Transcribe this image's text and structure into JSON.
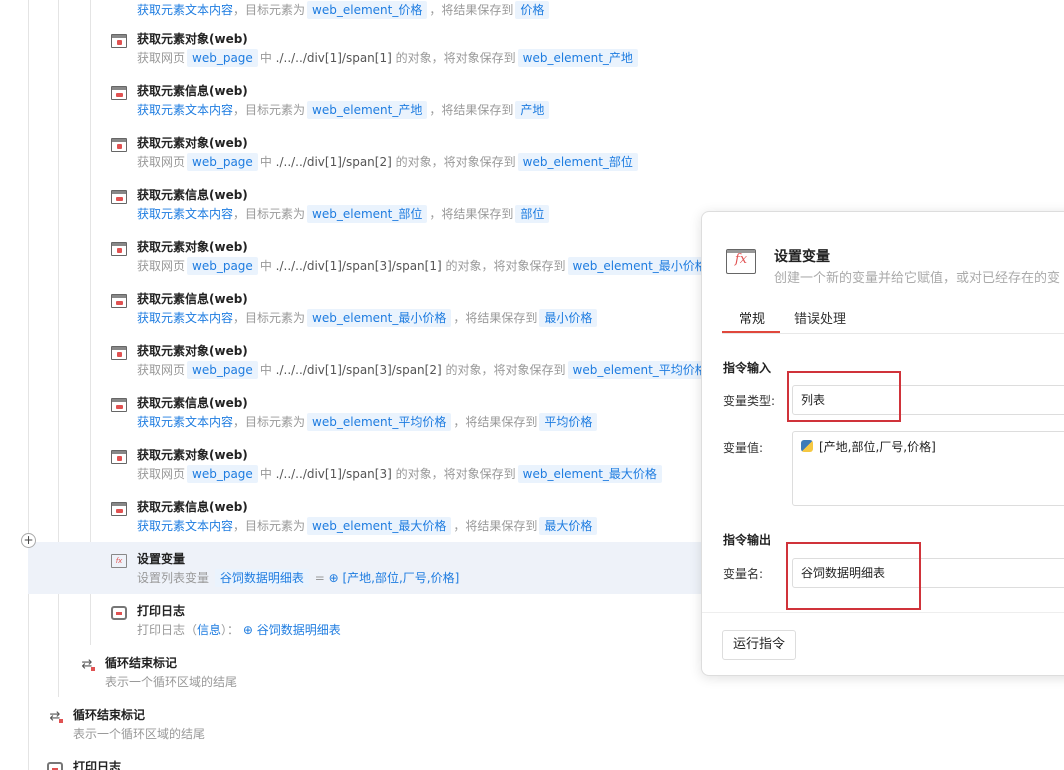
{
  "steps": [
    {
      "title": "",
      "desc_prefix": "获取元素文本内容",
      "sep1": "，目标元素为",
      "target": "web_element_价格",
      "sep2": "，将结果保存到",
      "result": "价格"
    },
    {
      "title": "获取元素对象(web)",
      "desc_prefix": "获取网页",
      "page": "web_page",
      "mid": "中",
      "xpath": "./../../div[1]/span[1]",
      "suffix": "的对象，将对象保存到",
      "result": "web_element_产地"
    },
    {
      "title": "获取元素信息(web)",
      "desc_prefix": "获取元素文本内容",
      "sep1": "，目标元素为",
      "target": "web_element_产地",
      "sep2": "，将结果保存到",
      "result": "产地"
    },
    {
      "title": "获取元素对象(web)",
      "desc_prefix": "获取网页",
      "page": "web_page",
      "mid": "中",
      "xpath": "./../../div[1]/span[2]",
      "suffix": "的对象，将对象保存到",
      "result": "web_element_部位"
    },
    {
      "title": "获取元素信息(web)",
      "desc_prefix": "获取元素文本内容",
      "sep1": "，目标元素为",
      "target": "web_element_部位",
      "sep2": "，将结果保存到",
      "result": "部位"
    },
    {
      "title": "获取元素对象(web)",
      "desc_prefix": "获取网页",
      "page": "web_page",
      "mid": "中",
      "xpath": "./../../div[1]/span[3]/span[1]",
      "suffix": "的对象，将对象保存到",
      "result": "web_element_最小价格"
    },
    {
      "title": "获取元素信息(web)",
      "desc_prefix": "获取元素文本内容",
      "sep1": "，目标元素为",
      "target": "web_element_最小价格",
      "sep2": "，将结果保存到",
      "result": "最小价格"
    },
    {
      "title": "获取元素对象(web)",
      "desc_prefix": "获取网页",
      "page": "web_page",
      "mid": "中",
      "xpath": "./../../div[1]/span[3]/span[2]",
      "suffix": "的对象，将对象保存到",
      "result": "web_element_平均价格"
    },
    {
      "title": "获取元素信息(web)",
      "desc_prefix": "获取元素文本内容",
      "sep1": "，目标元素为",
      "target": "web_element_平均价格",
      "sep2": "，将结果保存到",
      "result": "平均价格"
    },
    {
      "title": "获取元素对象(web)",
      "desc_prefix": "获取网页",
      "page": "web_page",
      "mid": "中",
      "xpath": "./../../div[1]/span[3]",
      "suffix": "的对象，将对象保存到",
      "result": "web_element_最大价格"
    },
    {
      "title": "获取元素信息(web)",
      "desc_prefix": "获取元素文本内容",
      "sep1": "，目标元素为",
      "target": "web_element_最大价格",
      "sep2": "，将结果保存到",
      "result": "最大价格"
    }
  ],
  "set_var_step": {
    "title": "设置变量",
    "desc_prefix": "设置列表变量",
    "var": "谷饲数据明细表",
    "eq": "=",
    "value": "[产地,部位,厂号,价格]"
  },
  "log_step": {
    "title": "打印日志",
    "desc_prefix": "打印日志",
    "paren_open": "（",
    "level": "信息",
    "paren_close": "）：",
    "value": "谷饲数据明细表"
  },
  "loop_end_inner": {
    "title": "循环结束标记",
    "desc": "表示一个循环区域的结尾"
  },
  "loop_end_outer": {
    "title": "循环结束标记",
    "desc": "表示一个循环区域的结尾"
  },
  "log_step_bottom": {
    "title": "打印日志"
  },
  "plus_symbol": "+",
  "dialog": {
    "icon_glyph": "fx",
    "title": "设置变量",
    "subtitle": "创建一个新的变量并给它赋值，或对已经存在的变",
    "tabs": [
      "常规",
      "错误处理"
    ],
    "input_section": "指令输入",
    "var_type_label": "变量类型:",
    "var_type_value": "列表",
    "var_value_label": "变量值:",
    "var_value": "[产地,部位,厂号,价格]",
    "output_section": "指令输出",
    "var_name_label": "变量名:",
    "var_name_value": "谷饲数据明细表",
    "run_button": "运行指令"
  },
  "colors": {
    "accent": "#e0473c",
    "link": "#1e7ce0",
    "tag_bg": "#eaf3fd",
    "highlight_box": "#d0333a",
    "selected_row": "#eef2f9"
  }
}
